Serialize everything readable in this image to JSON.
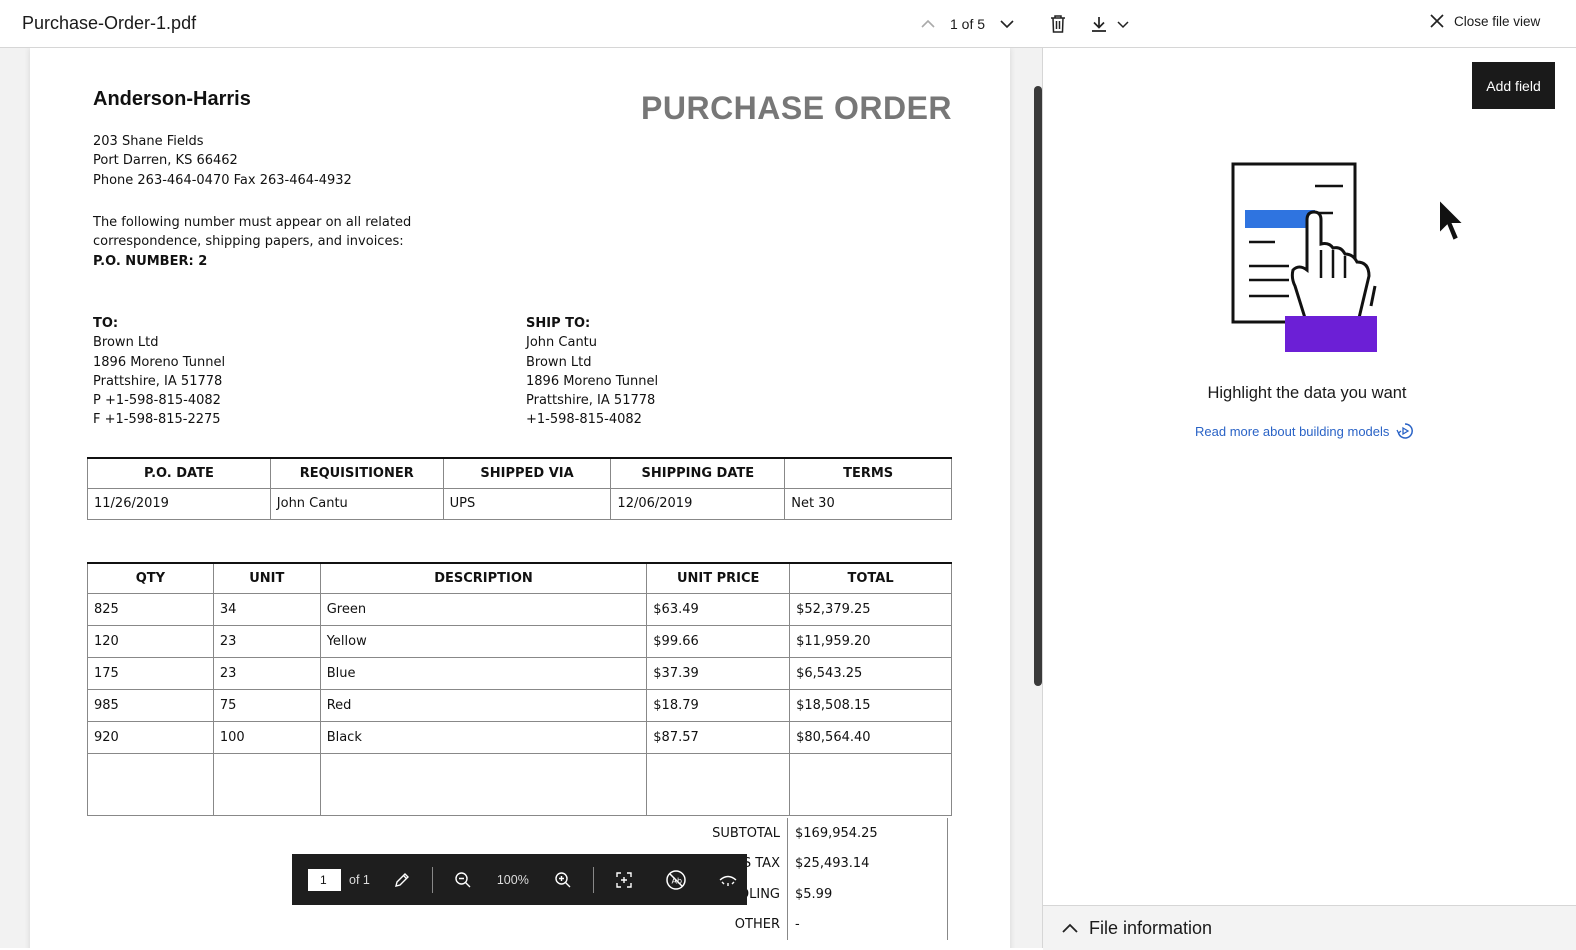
{
  "header": {
    "file_name": "Purchase-Order-1.pdf",
    "page_indicator": "1 of 5",
    "close_label": "Close file view"
  },
  "document": {
    "company": "Anderson-Harris",
    "heading": "PURCHASE ORDER",
    "address": [
      "203 Shane Fields",
      "Port Darren, KS 66462",
      "Phone 263-464-0470  Fax 263-464-4932"
    ],
    "notice": [
      "The following number must appear on all related",
      "correspondence, shipping papers, and invoices:"
    ],
    "po_number": "P.O. NUMBER: 2",
    "to": {
      "label": "TO:",
      "lines": [
        "Brown Ltd",
        "1896 Moreno Tunnel",
        "Prattshire, IA 51778",
        "P +1-598-815-4082",
        "F +1-598-815-2275"
      ]
    },
    "ship_to": {
      "label": "SHIP TO:",
      "lines": [
        "John Cantu",
        "Brown Ltd",
        "1896 Moreno Tunnel",
        "Prattshire, IA 51778",
        "+1-598-815-4082"
      ]
    },
    "info_table": {
      "headers": [
        "P.O. DATE",
        "REQUISITIONER",
        "SHIPPED VIA",
        "SHIPPING DATE",
        "TERMS"
      ],
      "row": [
        "11/26/2019",
        "John Cantu",
        "UPS",
        "12/06/2019",
        "Net 30"
      ]
    },
    "items_table": {
      "headers": [
        "QTY",
        "UNIT",
        "DESCRIPTION",
        "UNIT PRICE",
        "TOTAL"
      ],
      "rows": [
        [
          "825",
          "34",
          "Green",
          "$63.49",
          "$52,379.25"
        ],
        [
          "120",
          "23",
          "Yellow",
          "$99.66",
          "$11,959.20"
        ],
        [
          "175",
          "23",
          "Blue",
          "$37.39",
          "$6,543.25"
        ],
        [
          "985",
          "75",
          "Red",
          "$18.79",
          "$18,508.15"
        ],
        [
          "920",
          "100",
          "Black",
          "$87.57",
          "$80,564.40"
        ]
      ]
    },
    "totals": [
      {
        "label": "SUBTOTAL",
        "value": "$169,954.25"
      },
      {
        "label": "ES TAX",
        "value": "$25,493.14"
      },
      {
        "label": "DLING",
        "value": "$5.99"
      },
      {
        "label": "OTHER",
        "value": "-"
      }
    ]
  },
  "pdf_toolbar": {
    "page_value": "1",
    "of_label": "of 1",
    "zoom": "100%"
  },
  "right_panel": {
    "add_field_label": "Add field",
    "highlight_title": "Highlight the data you want",
    "read_more_label": "Read more about building models",
    "file_info_label": "File information"
  },
  "colors": {
    "accent_link": "#2a63c6",
    "illustration_purple": "#6c1fd6",
    "illustration_blue": "#2f74e0"
  }
}
